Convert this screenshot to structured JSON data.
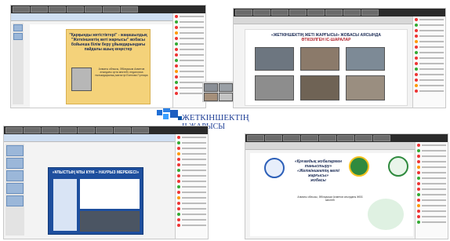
{
  "center": {
    "line1": "ЖЕТКІНШЕКТІҢ",
    "line2": "ІІ ЖАРЫСЫ"
  },
  "panel_top_left": {
    "slide_title": "\"Қарқынды жетістіктері\" - жаңашылдық \"Жеткіншектің жеті жарғысы\" жобасы бойынша білім беру ұйымдарындағы пайдалы ашық кеңестер",
    "presenter_caption": "Алматы облысы, Әбілқасым Ахметов атындағы ортa мектебі, педагогика ғылымдарының магистрі Есенова Гүлнара"
  },
  "panel_top_right": {
    "slide_title": "«ЖЕТКІНШЕКТІҢ ЖЕТІ ЖАРҒЫСЫ» ЖОБАСЫ АЯСЫНДА",
    "slide_subtitle": "ӨТКІЗІЛГЕН ІС-ШАРАЛАР"
  },
  "panel_bottom_left": {
    "slide_title": "«ҰЛЫСТЫҢ ҰЛЫ КҮНІ – НАУРЫЗ МЕРЕКЕСІ»"
  },
  "panel_bottom_right": {
    "slide_title_1": "«Қоғамдық жобалармен таныстыру»",
    "slide_title_2": "«Жеткіншектің жеті жарғысы»",
    "slide_title_3": "жобасы",
    "caption": "Алматы облысы, Әбілқасым Ахметов атындағы ЖББ мектебі"
  },
  "colors": {
    "accent": "#1f3f96",
    "gold": "#f4d27a",
    "slide_blue": "#1e4f9e"
  }
}
